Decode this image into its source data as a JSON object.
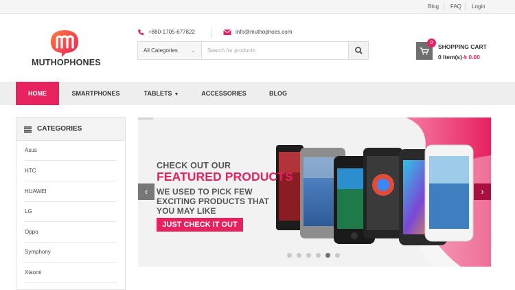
{
  "topbar": {
    "links": [
      "Blog",
      "FAQ",
      "Login"
    ]
  },
  "brand": {
    "logo_letter": "m",
    "name": "MUTHOPHONES"
  },
  "contact": {
    "phone": "+880-1705-677822",
    "email": "info@muthophoes.com"
  },
  "search": {
    "category_value": "All Categories",
    "placeholder": "Search for products"
  },
  "cart": {
    "badge": "0",
    "title": "SHOPPING CART",
    "items_label": "0 Item(s)-",
    "amount": "৳ 0.00"
  },
  "nav": {
    "items": [
      "HOME",
      "SMARTPHONES",
      "TABLETS",
      "ACCESSORIES",
      "BLOG"
    ],
    "active": "HOME"
  },
  "sidebar": {
    "title": "CATEGORIES",
    "categories": [
      "Asus",
      "HTC",
      "HUAWEI",
      "LG",
      "Oppo",
      "Symphony",
      "Xiaomi"
    ]
  },
  "slider": {
    "line1": "CHECK OUT OUR",
    "line2": "FEATURED PRODUCTS",
    "line3": "WE USED TO PICK FEW EXCITING PRODUCTS THAT YOU MAY LIKE",
    "cta": "JUST CHECK IT OUT",
    "dot_count": 6,
    "active_dot": 5
  },
  "colors": {
    "accent": "#e6225f",
    "accent_dark": "#a7103f",
    "text": "#333333"
  },
  "icons": [
    "phone-icon",
    "mail-icon",
    "search-icon",
    "cart-icon",
    "list-icon",
    "chevron-left-icon",
    "chevron-right-icon",
    "caret-down-icon"
  ]
}
